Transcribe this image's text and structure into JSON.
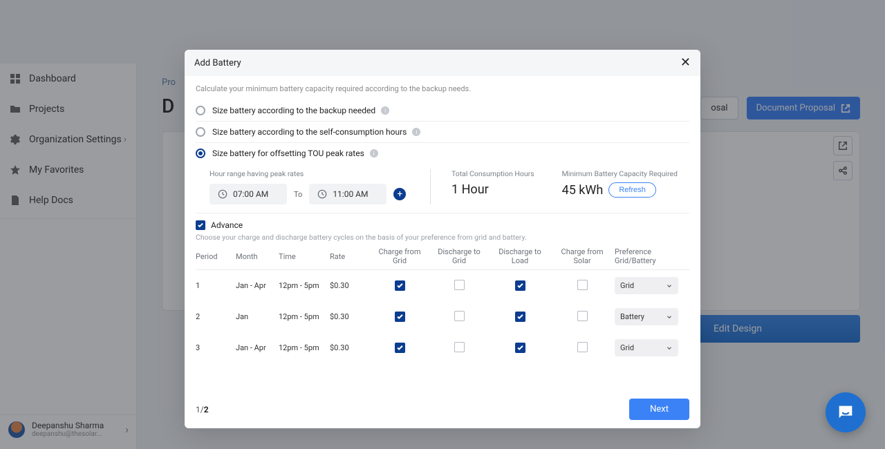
{
  "sidebar": {
    "items": [
      {
        "label": "Dashboard"
      },
      {
        "label": "Projects"
      },
      {
        "label": "Organization Settings"
      },
      {
        "label": "My Favorites"
      },
      {
        "label": "Help Docs"
      }
    ],
    "user": {
      "name": "Deepanshu Sharma",
      "email": "deepanshu@thesolar..."
    }
  },
  "page": {
    "breadcrumb": "Pro",
    "title": "D",
    "btn_outline": "osal",
    "btn_primary": "Document Proposal",
    "edit_design": "Edit Design"
  },
  "modal": {
    "title": "Add Battery",
    "subtitle": "Calculate your minimum battery capacity required according to the backup needs.",
    "options": [
      "Size battery according to the backup needed",
      "Size battery according to the self-consumption hours",
      "Size battery for offsetting TOU peak rates"
    ],
    "tou": {
      "label": "Hour range having peak rates",
      "from": "07:00 AM",
      "to_text": "To",
      "to": "11:00 AM",
      "total_label": "Total Consumption Hours",
      "total_value": "1 Hour",
      "cap_label": "Minimum Battery Capacity Required",
      "cap_value": "45 kWh",
      "refresh": "Refresh"
    },
    "advance": {
      "label": "Advance",
      "sub": "Choose your charge and discharge battery cycles on the basis of your preference from grid and battery."
    },
    "grid": {
      "headers": [
        "Period",
        "Month",
        "Time",
        "Rate",
        "Charge from Grid",
        "Discharge to Grid",
        "Discharge to Load",
        "Charge from Solar",
        "Preference Grid/Battery"
      ],
      "rows": [
        {
          "period": "1",
          "month": "Jan - Apr",
          "time": "12pm - 5pm",
          "rate": "$0.30",
          "cfg": true,
          "dtg": false,
          "dtl": true,
          "cfs": false,
          "pref": "Grid"
        },
        {
          "period": "2",
          "month": "Jan",
          "time": "12pm - 5pm",
          "rate": "$0.30",
          "cfg": true,
          "dtg": false,
          "dtl": true,
          "cfs": false,
          "pref": "Battery"
        },
        {
          "period": "3",
          "month": "Jan - Apr",
          "time": "12pm - 5pm",
          "rate": "$0.30",
          "cfg": true,
          "dtg": false,
          "dtl": true,
          "cfs": false,
          "pref": "Grid"
        }
      ]
    },
    "pager_current": "1",
    "pager_total": "2",
    "slash": "/",
    "next": "Next"
  }
}
